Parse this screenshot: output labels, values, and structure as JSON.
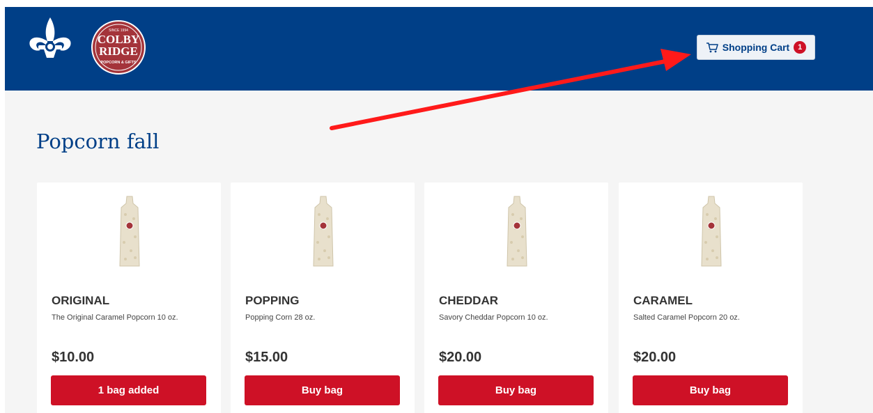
{
  "header": {
    "bsa_logo": "fleur-de-lis-logo",
    "partner_logo": {
      "line1": "SINCE 1994",
      "line2": "COLBY",
      "line3": "RIDGE",
      "line4": "POPCORN & GIFTS"
    },
    "cart": {
      "label": "Shopping Cart",
      "count": "1",
      "icon": "cart-icon"
    }
  },
  "page": {
    "title": "Popcorn fall"
  },
  "products": [
    {
      "name": "ORIGINAL",
      "description": "The Original Caramel Popcorn 10 oz.",
      "price": "$10.00",
      "button": "1 bag added"
    },
    {
      "name": "POPPING",
      "description": "Popping Corn 28 oz.",
      "price": "$15.00",
      "button": "Buy bag"
    },
    {
      "name": "CHEDDAR",
      "description": "Savory Cheddar Popcorn 10 oz.",
      "price": "$20.00",
      "button": "Buy bag"
    },
    {
      "name": "CARAMEL",
      "description": "Salted Caramel Popcorn 20 oz.",
      "price": "$20.00",
      "button": "Buy bag"
    }
  ],
  "colors": {
    "header_bg": "#003f87",
    "accent_red": "#ce1126",
    "page_bg": "#f5f5f5",
    "annotation_arrow": "#ff1a1a"
  }
}
